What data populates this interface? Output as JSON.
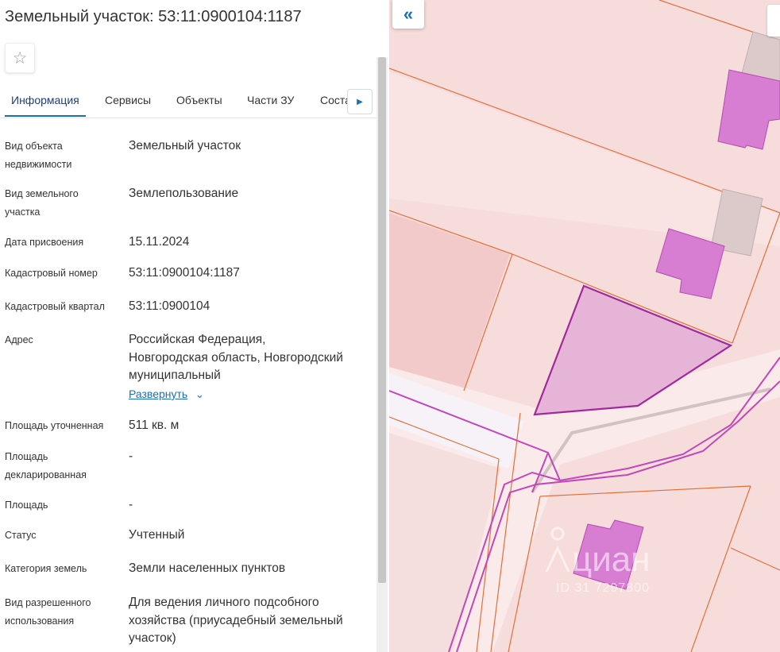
{
  "header": {
    "title": "Земельный участок: 53:11:0900104:1187"
  },
  "tabs": [
    {
      "label": "Информация"
    },
    {
      "label": "Сервисы"
    },
    {
      "label": "Объекты"
    },
    {
      "label": "Части ЗУ"
    },
    {
      "label": "Соста"
    }
  ],
  "rows": [
    {
      "label": "Вид объекта недвижимости",
      "value": "Земельный участок"
    },
    {
      "label": "Вид земельного участка",
      "value": "Землепользование"
    },
    {
      "label": "Дата присвоения",
      "value": "15.11.2024"
    },
    {
      "label": "Кадастровый номер",
      "value": "53:11:0900104:1187"
    },
    {
      "label": "Кадастровый квартал",
      "value": "53:11:0900104"
    },
    {
      "label": "Адрес",
      "value": "Российская Федерация, Новгородская область, Новгородский муниципальный",
      "link": "Развернуть"
    },
    {
      "label": "Площадь уточненная",
      "value": "511 кв. м"
    },
    {
      "label": "Площадь декларированная",
      "value": "-"
    },
    {
      "label": "Площадь",
      "value": "-"
    },
    {
      "label": "Статус",
      "value": "Учтенный"
    },
    {
      "label": "Категория земель",
      "value": "Земли населенных пунктов"
    },
    {
      "label": "Вид разрешенного использования",
      "value": "Для ведения личного подсобного хозяйства (приусадебный земельный участок)"
    }
  ],
  "map": {
    "watermark": "циан",
    "watermark_id": "ID 31 7297800",
    "colors": {
      "parcel_fill": "#f7dcdc",
      "parcel_border": "#e0703c",
      "selected_parcel_fill": "#e6b4d6",
      "selected_parcel_border": "#a02a9c",
      "building_fill": "#d77ed3",
      "building_border": "#b54cb0",
      "road_line": "#c048b8",
      "accent": "#1b6fb3"
    }
  },
  "icons": {
    "favorite": "star-outline-icon",
    "tab_next": "triangle-right-icon",
    "collapse": "double-chevron-left-icon",
    "expand": "chevron-down-icon"
  }
}
